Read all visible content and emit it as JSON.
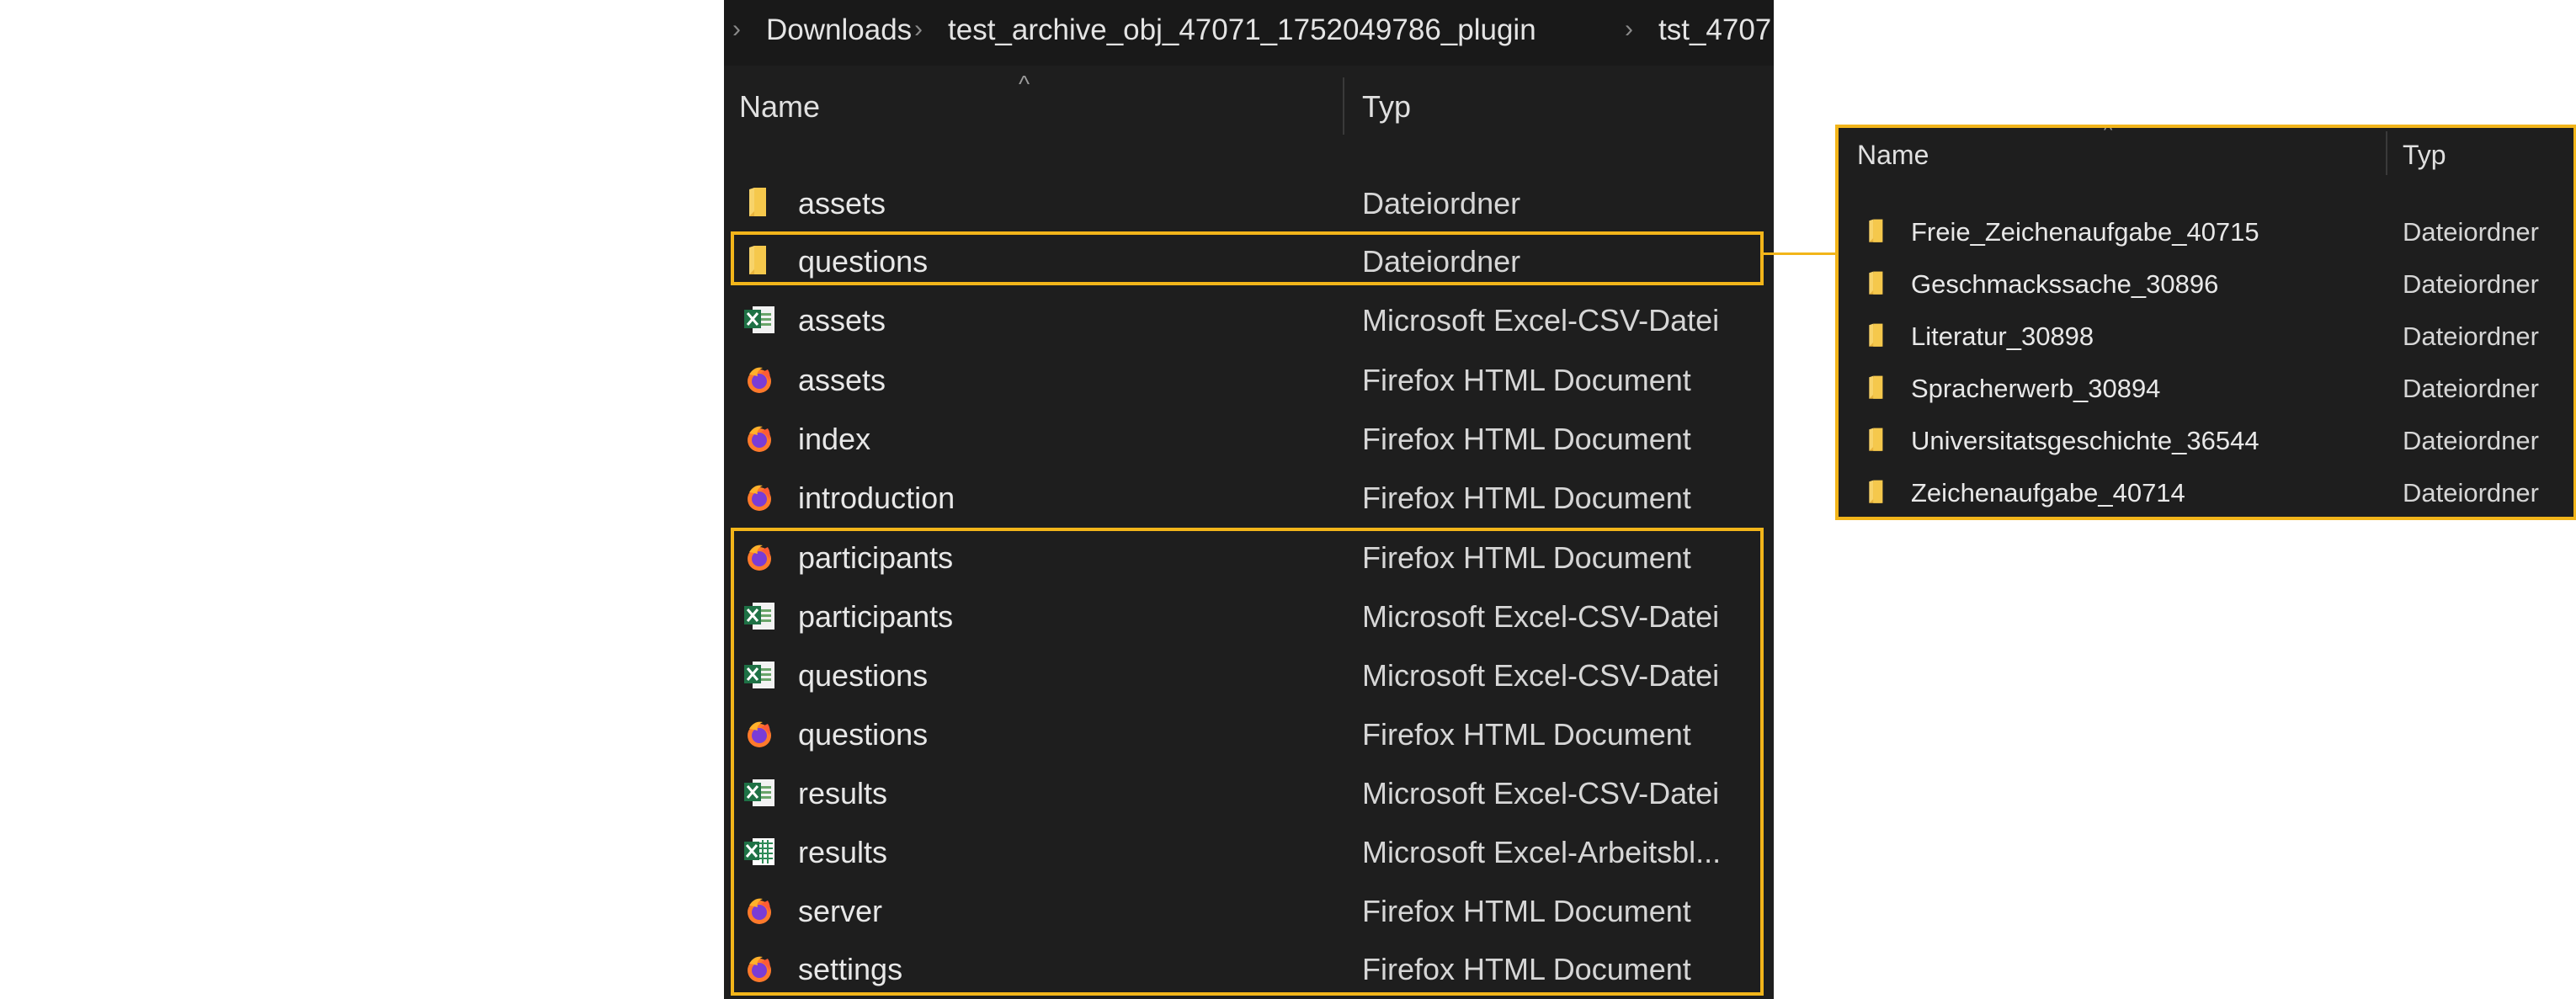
{
  "breadcrumb": [
    "Downloads",
    "test_archive_obj_47071_1752049786_plugin",
    "tst_4707"
  ],
  "main_list": {
    "columns": {
      "name": "Name",
      "type": "Typ"
    },
    "rows": [
      {
        "name": "assets",
        "type": "Dateiordner",
        "icon": "folder-icon"
      },
      {
        "name": "questions",
        "type": "Dateiordner",
        "icon": "folder-icon"
      },
      {
        "name": "assets",
        "type": "Microsoft Excel-CSV-Datei",
        "icon": "excel-csv-icon"
      },
      {
        "name": "assets",
        "type": "Firefox HTML Document",
        "icon": "firefox-html-icon"
      },
      {
        "name": "index",
        "type": "Firefox HTML Document",
        "icon": "firefox-html-icon"
      },
      {
        "name": "introduction",
        "type": "Firefox HTML Document",
        "icon": "firefox-html-icon"
      },
      {
        "name": "participants",
        "type": "Firefox HTML Document",
        "icon": "firefox-html-icon"
      },
      {
        "name": "participants",
        "type": "Microsoft Excel-CSV-Datei",
        "icon": "excel-csv-icon"
      },
      {
        "name": "questions",
        "type": "Microsoft Excel-CSV-Datei",
        "icon": "excel-csv-icon"
      },
      {
        "name": "questions",
        "type": "Firefox HTML Document",
        "icon": "firefox-html-icon"
      },
      {
        "name": "results",
        "type": "Microsoft Excel-CSV-Datei",
        "icon": "excel-csv-icon"
      },
      {
        "name": "results",
        "type": "Microsoft Excel-Arbeitsbl...",
        "icon": "excel-workbook-icon"
      },
      {
        "name": "server",
        "type": "Firefox HTML Document",
        "icon": "firefox-html-icon"
      },
      {
        "name": "settings",
        "type": "Firefox HTML Document",
        "icon": "firefox-html-icon"
      }
    ]
  },
  "questions_folder": {
    "columns": {
      "name": "Name",
      "type": "Typ"
    },
    "rows": [
      {
        "name": "Freie_Zeichenaufgabe_40715",
        "type": "Dateiordner",
        "icon": "folder-icon"
      },
      {
        "name": "Geschmackssache_30896",
        "type": "Dateiordner",
        "icon": "folder-icon"
      },
      {
        "name": "Literatur_30898",
        "type": "Dateiordner",
        "icon": "folder-icon"
      },
      {
        "name": "Spracherwerb_30894",
        "type": "Dateiordner",
        "icon": "folder-icon"
      },
      {
        "name": "Universitatsgeschichte_36544",
        "type": "Dateiordner",
        "icon": "folder-icon"
      },
      {
        "name": "Zeichenaufgabe_40714",
        "type": "Dateiordner",
        "icon": "folder-icon"
      }
    ]
  },
  "colors": {
    "highlight": "#f2b51a",
    "background": "#1e1e1e",
    "text": "#e8e8e8"
  }
}
